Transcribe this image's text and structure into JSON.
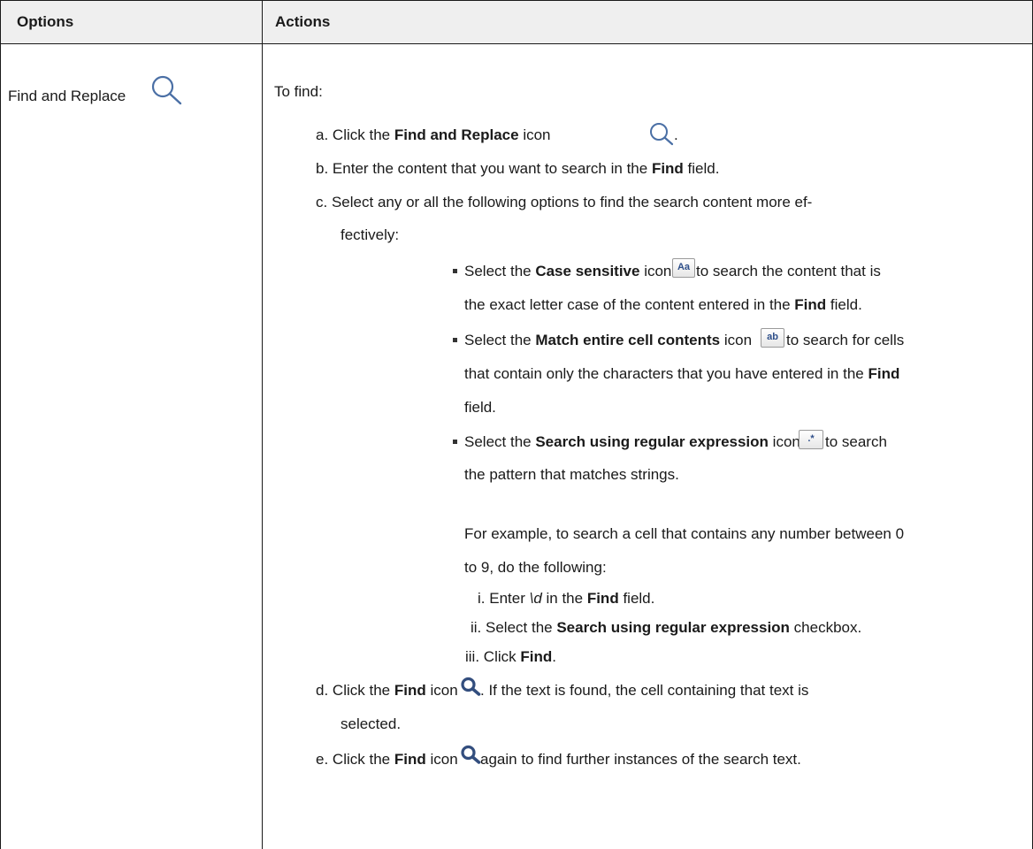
{
  "table": {
    "headers": {
      "options": "Options",
      "actions": "Actions"
    },
    "option_label": "Find and Replace",
    "intro": "To find:",
    "steps": {
      "a": {
        "marker": "a.",
        "pre": "Click the ",
        "b1": "Find and Replace",
        "post": " icon",
        "end": "."
      },
      "b": {
        "marker": "b.",
        "pre": "Enter the content that you want to search in the ",
        "b1": "Find",
        "post": " field."
      },
      "c": {
        "marker": "c.",
        "line1": "Select any or all the following options to find the search content more ef-",
        "line2": "fectively:"
      },
      "bullets": [
        {
          "pre": "Select the ",
          "b1": "Case sensitive",
          "mid": " icon",
          "after": " to search the content that is",
          "line2_pre": "the exact letter case of the content entered in the ",
          "line2_b": "Find",
          "line2_post": " field.",
          "icon_glyph": "Aa"
        },
        {
          "pre": "Select the ",
          "b1": "Match entire cell contents",
          "mid": " icon",
          "after": " to search for cells",
          "line2_pre": "that contain only the characters that you have entered in the ",
          "line2_b": "Find",
          "line3": "field.",
          "icon_glyph": "ab"
        },
        {
          "pre": "Select the ",
          "b1": "Search using regular expression",
          "mid": " icon",
          "after": " to search",
          "line2": "the pattern that matches strings.",
          "icon_glyph": ".*"
        }
      ],
      "example": {
        "line1": "For example, to search a cell that contains any number between 0",
        "line2": "to 9, do the following:"
      },
      "substeps": [
        {
          "marker": "i.",
          "pre": "Enter ",
          "code": "\\d",
          "mid": " in the ",
          "b1": "Find",
          "post": " field."
        },
        {
          "marker": "ii.",
          "pre": "Select the ",
          "b1": "Search using regular expression",
          "post": " checkbox."
        },
        {
          "marker": "iii.",
          "pre": "Click ",
          "b1": "Find",
          "post": "."
        }
      ],
      "d": {
        "marker": "d.",
        "pre": "Click the ",
        "b1": "Find",
        "post": " icon",
        "after": ". If the text is found, the cell containing that text is",
        "line2": "selected."
      },
      "e": {
        "marker": "e.",
        "pre": "Click the ",
        "b1": "Find",
        "post": " icon",
        "after": " again to find further instances of the search text."
      }
    }
  },
  "colors": {
    "border": "#1a1a1a",
    "header_bg": "#efefef",
    "icon_stroke": "#4a6fa5",
    "icon_solid": "#334e7e"
  },
  "icons": [
    "search-outline-icon",
    "case-sensitive-icon",
    "match-entire-cell-icon",
    "regex-icon",
    "search-solid-icon"
  ]
}
